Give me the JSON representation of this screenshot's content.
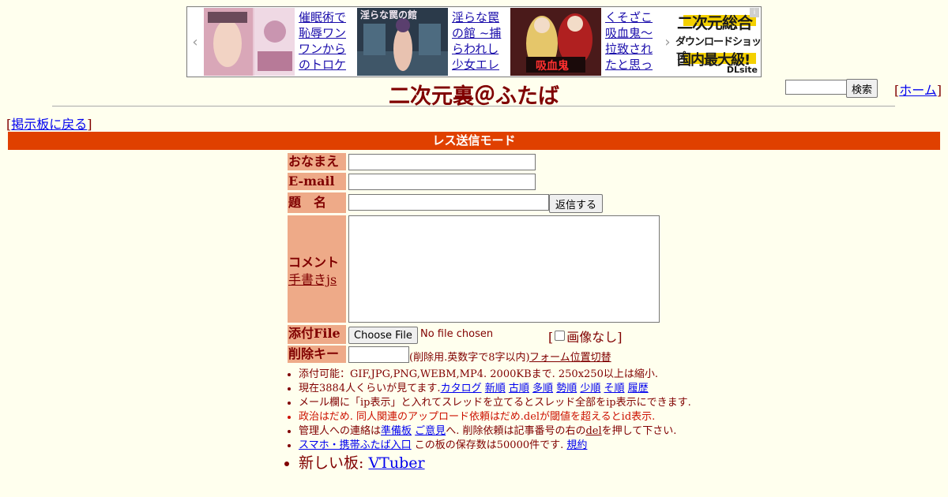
{
  "ad": {
    "prev": "‹",
    "next": "›",
    "items": [
      {
        "title": "催眠術で恥辱ワンワンからのトロケ"
      },
      {
        "title": "淫らな罠の館 ~捕らわれし少女エレ",
        "thumb_text": "淫らな罠の館"
      },
      {
        "title": "くそざこ吸血鬼～拉致されたと思っ",
        "thumb_text": "吸血鬼"
      }
    ],
    "brand": {
      "line1": "二次元総合",
      "line2": "ダウンロードショップ",
      "line3": "国内最大級!",
      "logo": "DLsite"
    }
  },
  "search": {
    "button": "検索"
  },
  "home": {
    "link": "ホーム"
  },
  "site_title": "二次元裏＠ふたば",
  "back_link": "掲示板に戻る",
  "mode": "レス送信モード",
  "form": {
    "name_label": "おなまえ",
    "email_label": "E-mail",
    "subject_label": "題　名",
    "reply_button": "返信する",
    "comment_label": "コメント",
    "handwrite_link": "手書きjs",
    "file_label": "添付File",
    "choose_file": "Choose File",
    "no_file": "No file chosen",
    "no_image": "画像なし",
    "delkey_label": "削除キー",
    "delkey_note": "(削除用.英数字で8字以内)",
    "form_switch": "フォーム位置切替"
  },
  "rules": {
    "r1": "添付可能：GIF,JPG,PNG,WEBM,MP4. 2000KBまで. 250x250以上は縮小.",
    "r2_prefix": "現在3884人くらいが見てます.",
    "r2_links": [
      "カタログ",
      "新順",
      "古順",
      "多順",
      "勢順",
      "少順",
      "そ順",
      "履歴"
    ],
    "r3": "メール欄に「ip表示」と入れてスレッドを立てるとスレッド全部をip表示にできます.",
    "r4": "政治はだめ. 同人関連のアップロード依頼はだめ.delが閾値を超えるとid表示.",
    "r5_a": "管理人への連絡は",
    "r5_link1": "準備板",
    "r5_link2": "ご意見",
    "r5_b": "へ. 削除依頼は記事番号の右の",
    "r5_link3": "del",
    "r5_c": "を押して下さい.",
    "r6_link": "スマホ・携帯ふたば入口",
    "r6_text": "この板の保存数は50000件です.",
    "r6_link2": "規約",
    "r7_text": "新しい板:",
    "r7_link": "VTuber"
  },
  "colors": {
    "background": "#FFFFEE",
    "text": "#800000",
    "mode_bar": "#E04000",
    "label_bg": "#EEAA88",
    "link": "#0000EE"
  }
}
